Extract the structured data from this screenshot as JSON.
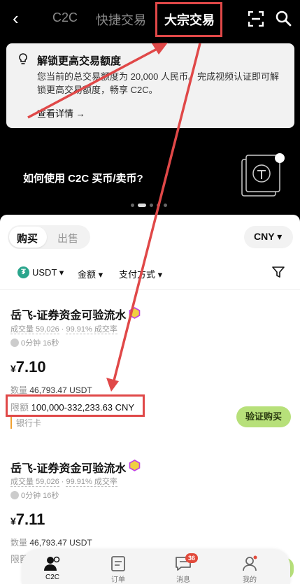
{
  "nav": {
    "tabs": [
      "C2C",
      "快捷交易",
      "大宗交易"
    ],
    "active_tab": "大宗交易"
  },
  "banner": {
    "title": "解锁更高交易额度",
    "description": "您当前的总交易额度为 20,000 人民币。完成视频认证即可解锁更高交易额度，畅享 C2C。",
    "link": "查看详情 →"
  },
  "promo": {
    "text": "如何使用 C2C 买币/卖币?"
  },
  "trade": {
    "buy_tab": "购买",
    "sell_tab": "出售",
    "currency": "CNY"
  },
  "filters": {
    "coin": "USDT",
    "amount": "金额",
    "payment": "支付方式"
  },
  "listings": [
    {
      "merchant": "岳飞-证券资金可验流水",
      "volume": "成交量 59,026",
      "completion": "99.91% 成交率",
      "time": "0分钟 16秒",
      "currency_symbol": "¥",
      "price": "7.10",
      "quantity_label": "数量",
      "quantity": "46,793.47 USDT",
      "limit_label": "限额",
      "limit": "100,000-332,233.63 CNY",
      "payment": "银行卡",
      "action": "验证购买"
    },
    {
      "merchant": "岳飞-证券资金可验流水",
      "volume": "成交量 59,026",
      "completion": "99.91% 成交率",
      "time": "0分钟 16秒",
      "currency_symbol": "¥",
      "price": "7.11",
      "quantity_label": "数量",
      "quantity": "46,793.47 USDT",
      "limit_label": "限额"
    }
  ],
  "bottom_nav": [
    {
      "label": "C2C",
      "icon": "person-icon",
      "active": true
    },
    {
      "label": "订单",
      "icon": "order-icon",
      "active": false
    },
    {
      "label": "消息",
      "icon": "message-icon",
      "active": false,
      "badge": "36"
    },
    {
      "label": "我的",
      "icon": "profile-icon",
      "active": false
    }
  ],
  "colors": {
    "accent": "#b7e07a",
    "annotation": "#e04848",
    "usdt": "#2aa58c"
  }
}
